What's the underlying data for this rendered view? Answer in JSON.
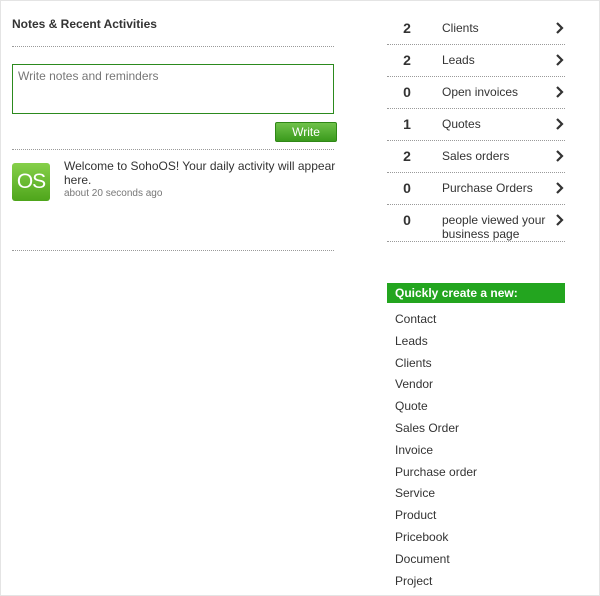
{
  "notes": {
    "title": "Notes & Recent Activities",
    "placeholder": "Write notes and reminders",
    "write_label": "Write"
  },
  "activity": {
    "logo_text": "OS",
    "message": "Welcome to SohoOS! Your daily activity will appear here.",
    "time": "about 20 seconds ago"
  },
  "stats": [
    {
      "count": "2",
      "label": "Clients"
    },
    {
      "count": "2",
      "label": "Leads"
    },
    {
      "count": "0",
      "label": "Open invoices"
    },
    {
      "count": "1",
      "label": "Quotes"
    },
    {
      "count": "2",
      "label": "Sales orders"
    },
    {
      "count": "0",
      "label": "Purchase Orders"
    },
    {
      "count": "0",
      "label": "people viewed your business page"
    }
  ],
  "quick_create": {
    "title": "Quickly create a new:",
    "items": [
      "Contact",
      "Leads",
      "Clients",
      "Vendor",
      "Quote",
      "Sales Order",
      "Invoice",
      "Purchase order",
      "Service",
      "Product",
      "Pricebook",
      "Document",
      "Project"
    ]
  },
  "colors": {
    "accent_green": "#23a51f",
    "input_border": "#2c8a1e"
  },
  "icons": {
    "chevron": "chevron-right-icon",
    "logo": "sohoos-logo"
  }
}
